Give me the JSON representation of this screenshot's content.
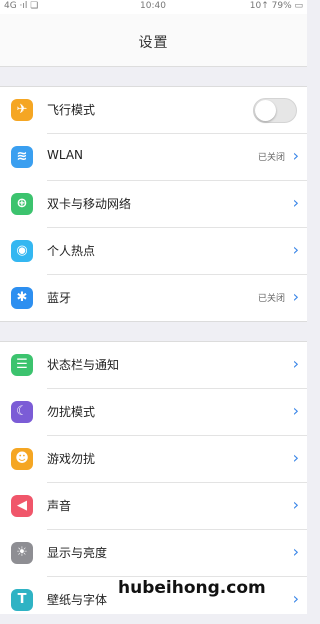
{
  "status_bar": {
    "left": "4G ·ıl ❏",
    "time": "10:40",
    "right": "10↑ 79% ▭"
  },
  "header": {
    "title": "设置"
  },
  "group1": [
    {
      "label": "飞行模式",
      "icon": "airplane-icon",
      "glyph": "✈",
      "color": "#f5a623",
      "value": "",
      "has_toggle": true,
      "toggle_on": false
    },
    {
      "label": "WLAN",
      "icon": "wifi-icon",
      "glyph": "≋",
      "color": "#3a9ff0",
      "value": "已关闭",
      "has_toggle": false
    },
    {
      "label": "双卡与移动网络",
      "icon": "globe-icon",
      "glyph": "⊕",
      "color": "#3cc36e",
      "value": "",
      "has_toggle": false
    },
    {
      "label": "个人热点",
      "icon": "hotspot-icon",
      "glyph": "◉",
      "color": "#34b7f1",
      "value": "",
      "has_toggle": false
    },
    {
      "label": "蓝牙",
      "icon": "bluetooth-icon",
      "glyph": "✱",
      "color": "#2d8ff0",
      "value": "已关闭",
      "has_toggle": false
    }
  ],
  "group2": [
    {
      "label": "状态栏与通知",
      "icon": "notification-icon",
      "glyph": "☰",
      "color": "#3cc36e",
      "value": ""
    },
    {
      "label": "勿扰模式",
      "icon": "moon-icon",
      "glyph": "☾",
      "color": "#7b5cd6",
      "value": ""
    },
    {
      "label": "游戏勿扰",
      "icon": "game-icon",
      "glyph": "☻",
      "color": "#f5a623",
      "value": ""
    },
    {
      "label": "声音",
      "icon": "speaker-icon",
      "glyph": "◀",
      "color": "#f0566a",
      "value": ""
    },
    {
      "label": "显示与亮度",
      "icon": "brightness-icon",
      "glyph": "☀",
      "color": "#8e8e93",
      "value": ""
    },
    {
      "label": "壁纸与字体",
      "icon": "font-icon",
      "glyph": "T",
      "color": "#2fb3c4",
      "value": ""
    }
  ],
  "watermark": "hubeihong.com"
}
